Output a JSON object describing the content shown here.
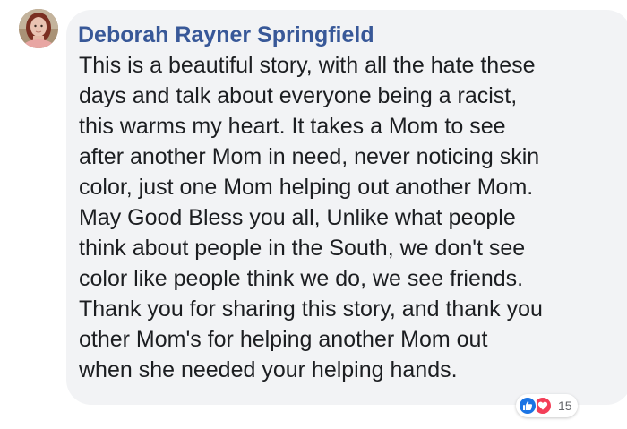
{
  "comment": {
    "author": "Deborah Rayner Springfield",
    "text_lines": [
      "This is a beautiful story, with all the hate these",
      "days and talk about everyone being a racist,",
      "this warms my heart. It takes a Mom to see",
      "after another Mom in need, never noticing skin",
      "color, just one Mom helping out another Mom.",
      "May Good Bless you all, Unlike what people",
      "think about people in the South, we don't see",
      "color like people think we do, we see friends.",
      "Thank you for sharing this story, and thank you",
      "other Mom's for helping another Mom out",
      "when she needed your helping hands."
    ],
    "reactions": {
      "icons": [
        "like-icon",
        "love-icon"
      ],
      "count": "15"
    }
  },
  "colors": {
    "author": "#385898",
    "bubble": "#f2f3f5",
    "text": "#1c1e21",
    "like": "#1b74e4",
    "love": "#f33e58"
  }
}
